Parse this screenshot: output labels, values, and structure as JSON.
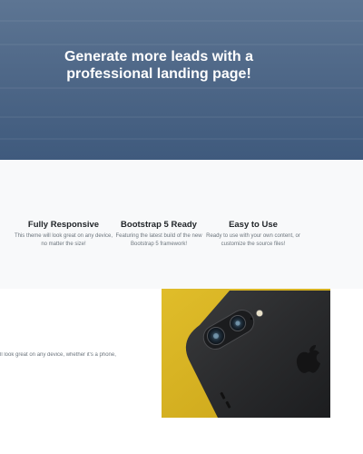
{
  "hero": {
    "title": "Generate more leads with a professional landing page!"
  },
  "features": [
    {
      "title": "Fully Responsive",
      "text": "This theme will look great on any device, no matter the size!"
    },
    {
      "title": "Bootstrap 5 Ready",
      "text": "Featuring the latest build of the new Bootstrap 5 framework!"
    },
    {
      "title": "Easy to Use",
      "text": "Ready to use with your own content, or customize the source files!"
    }
  ],
  "showcase": {
    "text": "ll look great on any device, whether it's a phone,"
  },
  "colors": {
    "hero_top": "#5d7593",
    "hero_bottom": "#3f5a7d",
    "features_bg": "#f8f9fa",
    "phone_bg": "#d8b21e",
    "phone_body": "#2b2c2e"
  }
}
